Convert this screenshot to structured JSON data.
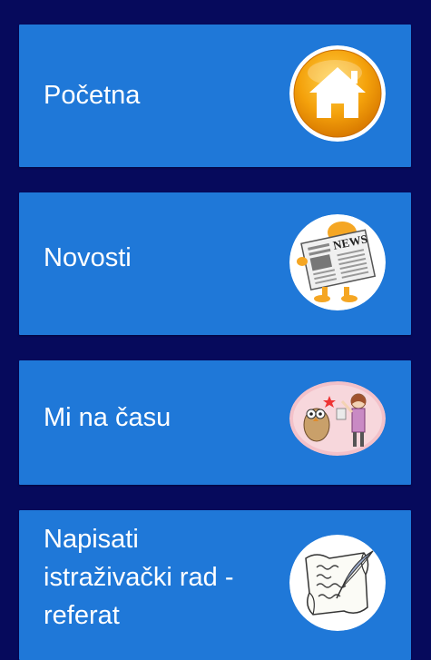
{
  "menu": {
    "items": [
      {
        "label": "Početna",
        "icon": "home-icon"
      },
      {
        "label": "Novosti",
        "icon": "newspaper-icon"
      },
      {
        "label": "Mi na času",
        "icon": "classroom-icon"
      },
      {
        "label": "Napisati istraživački rad - referat",
        "icon": "quill-manuscript-icon"
      }
    ]
  },
  "colors": {
    "background": "#060a5c",
    "card": "#1f78d8",
    "text": "#ffffff",
    "home_orange": "#f4a10b"
  }
}
